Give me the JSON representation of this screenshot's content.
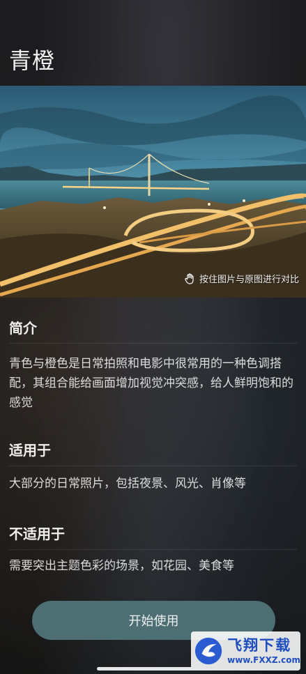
{
  "page": {
    "title": "青橙"
  },
  "hero": {
    "hint": "按住图片与原图进行对比"
  },
  "sections": [
    {
      "heading": "简介",
      "body": "青色与橙色是日常拍照和电影中很常用的一种色调搭配，其组合能给画面增加视觉冲突感，给人鲜明饱和的感觉"
    },
    {
      "heading": "适用于",
      "body": "大部分的日常照片，包括夜景、风光、肖像等"
    },
    {
      "heading": "不适用于",
      "body": "需要突出主题色彩的场景，如花园、美食等"
    }
  ],
  "actions": {
    "start_label": "开始使用"
  },
  "watermark": {
    "cn": "飞翔下载",
    "en": "www.FXXZ.com"
  },
  "colors": {
    "button": "#4d6f73",
    "background": "#161616",
    "teal": "#3a7f95",
    "orange": "#e0a050"
  }
}
